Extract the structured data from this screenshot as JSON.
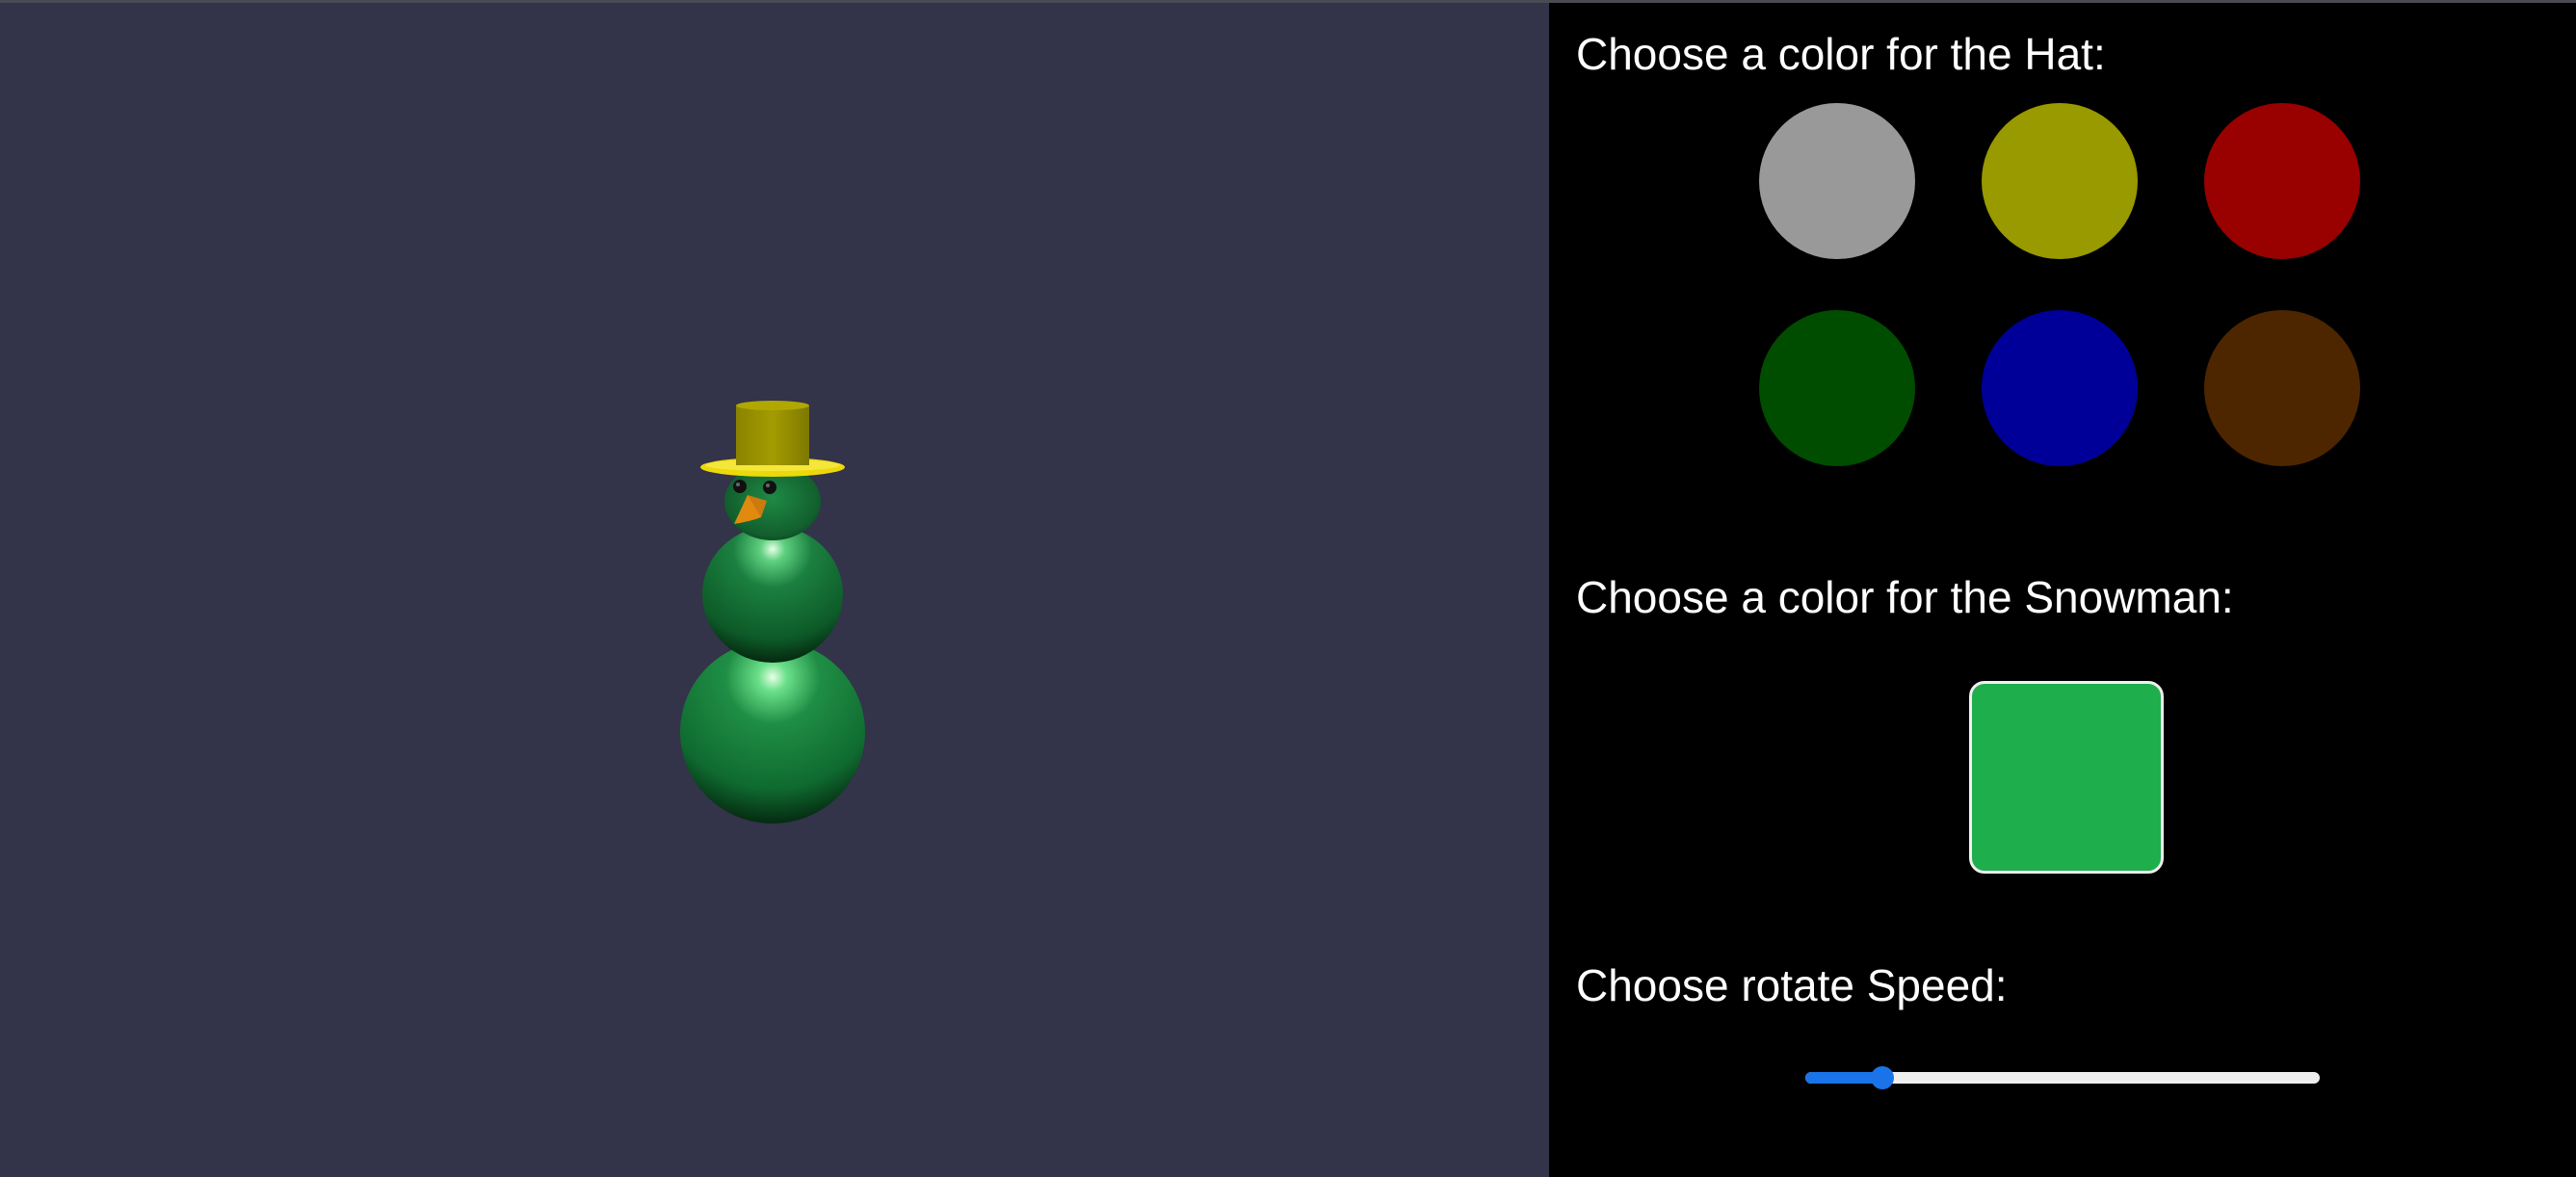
{
  "viewport": {
    "background": "#33334a",
    "snowman": {
      "body_color": "#1fae4c",
      "hat_color": "#9c9700",
      "brim_color": "#ecd90a",
      "nose_color": "#e08a10",
      "eye_color": "#111111"
    }
  },
  "hat_section": {
    "title": "Choose a color for the Hat:",
    "swatches": [
      {
        "name": "gray",
        "color": "#999999"
      },
      {
        "name": "yellow",
        "color": "#999900"
      },
      {
        "name": "red",
        "color": "#990000"
      },
      {
        "name": "green",
        "color": "#004d00"
      },
      {
        "name": "blue",
        "color": "#000099"
      },
      {
        "name": "brown",
        "color": "#4d2600"
      }
    ]
  },
  "snowman_section": {
    "title": "Choose a color for the Snowman:",
    "current_color": "#1fae4c"
  },
  "speed_section": {
    "title": "Choose rotate Speed:",
    "min": 0,
    "max": 100,
    "value": 15,
    "accent": "#1a73e8"
  }
}
